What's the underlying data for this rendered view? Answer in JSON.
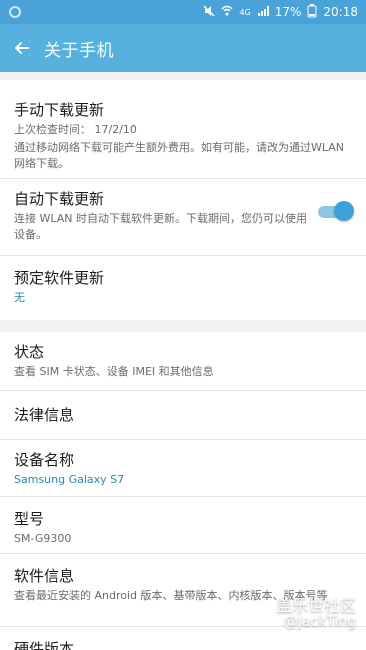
{
  "status_bar": {
    "signal_label": "4G",
    "battery": "17%",
    "time": "20:18",
    "icons": [
      "app-icon",
      "mute-icon",
      "wifi-icon",
      "signal-icon",
      "battery-icon"
    ]
  },
  "app_bar": {
    "title": "关于手机",
    "back_icon": "arrow-left-icon",
    "bg": "#56b1df"
  },
  "sections": [
    {
      "items": [
        {
          "title": "手动下载更新",
          "sub1": "上次检查时间： 17/2/10",
          "sub2": "通过移动网络下载可能产生额外费用。如有可能，请改为通过WLAN 网络下载。"
        },
        {
          "title": "自动下载更新",
          "sub1": "连接 WLAN 时自动下载软件更新。下载期间，您仍可以使用设备。",
          "toggle": true
        },
        {
          "title": "预定软件更新",
          "sub1": "无"
        }
      ]
    },
    {
      "items": [
        {
          "title": "状态",
          "sub1": "查看 SIM 卡状态、设备 IMEI 和其他信息"
        },
        {
          "title": "法律信息"
        },
        {
          "title": "设备名称",
          "sub1": "Samsung Galaxy S7"
        },
        {
          "title": "型号",
          "sub1": "SM-G9300"
        },
        {
          "title": "软件信息",
          "sub1": "查看最近安装的 Android 版本、基带版本、内核版本、版本号等"
        },
        {
          "title": "硬件版本"
        }
      ]
    }
  ],
  "watermark": {
    "line1": "盖乐世社区",
    "line2": "@JackTing"
  },
  "colors": {
    "accent": "#3ea2da",
    "teal": "#2a88ad"
  }
}
